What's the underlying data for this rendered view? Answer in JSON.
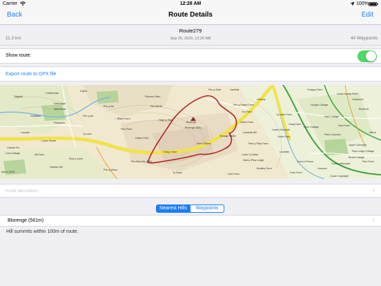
{
  "status_bar": {
    "carrier": "Carrier",
    "time": "12:28 AM",
    "battery": "100%"
  },
  "nav": {
    "back_label": "Back",
    "title": "Route Details",
    "edit_label": "Edit"
  },
  "route": {
    "name": "Route279",
    "date": "Sep 25, 2016, 12:25 AM",
    "distance": "11.3 km",
    "waypoints": "44 Waypoints"
  },
  "show_route": {
    "label": "Show route:",
    "enabled": true
  },
  "export": {
    "label": "Export route to GPX file"
  },
  "map": {
    "labels": [
      "Cheltenham",
      "Clytha",
      "Danh-lwyd",
      "Wauntaylor",
      "Goldfarm",
      "Penywern",
      "Llanarth",
      "Pen-y-fal",
      "Pen-ffordd",
      "Blorenge",
      "Blorenge (561)",
      "Pen-fford-Hir (592)",
      "Llanfoist",
      "Llanellen",
      "Hunger Cottage",
      "Pant Cottage",
      "Pant Farm",
      "Sewage Works",
      "Graig Farm",
      "Llansoy",
      "Caerwood",
      "Buckholt",
      "Pitch Common",
      "Coed y Person",
      "Lower House Farm",
      "Upper Ochrwyth",
      "Llanover",
      "Ton Farm",
      "Hafod Farm",
      "Pen-y-Gaer",
      "Twyn-y-Gaer",
      "Pen-y-Ffawd Farm",
      "Llanfoist Mill",
      "Pant-y-Ffwy Farm",
      "Hatton Fold",
      "Llethr Farm",
      "Lower Ochrwyth",
      "Park Lodge Cottage",
      "Parc Farm",
      "Gregory Farm",
      "Ty-mawr Farm",
      "Brook Cottage",
      "Clawdd Fm",
      "Cefn Cottage",
      "Hill Farm",
      "Pen-y-lan",
      "Fish Pond",
      "Lower Ty Mawr",
      "Talgarth",
      "Garn Cottage",
      "Hillcot",
      "Nant-y-Ffwy Lodge",
      "Graig y Gaer",
      "Coed-y-Bwynydd",
      "Blaen Farm",
      "Lower Pentre",
      "Ty-coch",
      "Ffynnon Farm",
      "Pen-y-Waun",
      "Heather Hill",
      "Pont-y-Cwm",
      "Aaron (324)",
      "Cwm Farm",
      "Wern Gifford",
      "Bradley Farm",
      "Cwrt Farm",
      "Ty Gwyn",
      "Crown Copyright"
    ]
  },
  "description": {
    "placeholder": "Route description..."
  },
  "segmented": {
    "options": [
      "Nearest Hills",
      "Waypoints"
    ],
    "selected": "Nearest Hills"
  },
  "hills": [
    {
      "name": "Blorenge (561m)"
    }
  ],
  "hills_note": "Hill summits within 100m of route.",
  "colors": {
    "accent": "#1c7ef8",
    "toggle_on": "#4cd964",
    "route": "#b22222"
  }
}
